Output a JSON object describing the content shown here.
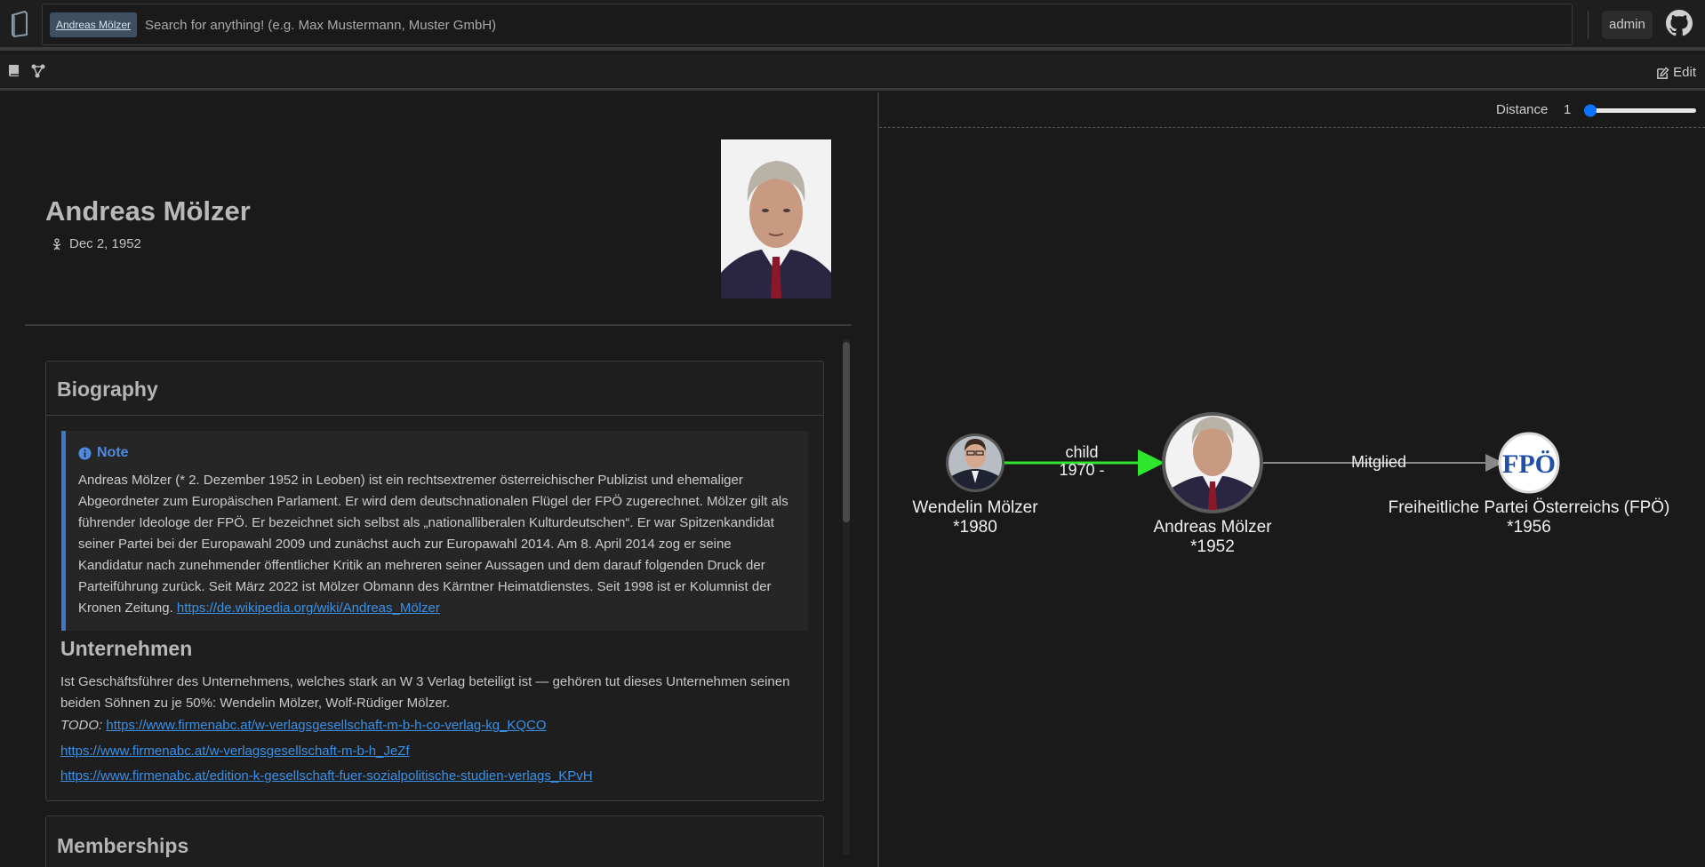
{
  "header": {
    "active_tag": "Andreas Mölzer",
    "search_placeholder": "Search for anything! (e.g. Max Mustermann, Muster GmbH)",
    "user_label": "admin"
  },
  "toolbar": {
    "edit_label": "Edit"
  },
  "person": {
    "name": "Andreas Mölzer",
    "birth_date": "Dec 2, 1952"
  },
  "biography": {
    "title": "Biography",
    "note_title": "Note",
    "note_text": "Andreas Mölzer (* 2. Dezember 1952 in Leoben) ist ein rechtsextremer österreichischer Publizist und ehemaliger Abgeordneter zum Europäischen Parlament. Er wird dem deutschnationalen Flügel der FPÖ zugerechnet. Mölzer gilt als führender Ideologe der FPÖ. Er bezeichnet sich selbst als „nationalliberalen Kulturdeutschen“. Er war Spitzenkandidat seiner Partei bei der Europawahl 2009 und zunächst auch zur Europawahl 2014. Am 8. April 2014 zog er seine Kandidatur nach zunehmender öffentlicher Kritik an mehreren seiner Aussagen und dem darauf folgenden Druck der Parteiführung zurück. Seit März 2022 ist Mölzer Obmann des Kärntner Heimatdienstes. Seit 1998 ist er Kolumnist der Kronen Zeitung. ",
    "note_link": "https://de.wikipedia.org/wiki/Andreas_Mölzer",
    "section_title": "Unternehmen",
    "section_text": "Ist Geschäftsführer des Unternehmens, welches stark an W 3 Verlag beteiligt ist — gehören tut dieses Unternehmen seinen beiden Söhnen zu je 50%: Wendelin Mölzer, Wolf-Rüdiger Mölzer.",
    "todo_label": "TODO:",
    "links": [
      "https://www.firmenabc.at/w-verlagsgesellschaft-m-b-h-co-verlag-kg_KQCO",
      "https://www.firmenabc.at/w-verlagsgesellschaft-m-b-h_JeZf",
      "https://www.firmenabc.at/edition-k-gesellschaft-fuer-sozialpolitische-studien-verlags_KPvH"
    ]
  },
  "memberships": {
    "title": "Memberships"
  },
  "graph": {
    "distance_label": "Distance",
    "distance_value": "1",
    "nodes": [
      {
        "name": "Wendelin Mölzer",
        "sub": "*1980"
      },
      {
        "name": "Andreas Mölzer",
        "sub": "*1952"
      },
      {
        "name": "Freiheitliche Partei Österreichs (FPÖ)",
        "sub": "*1956",
        "logo_text": "FPÖ"
      }
    ],
    "edges": [
      {
        "label": "child",
        "sub": "1970 -",
        "color": "#2ee62e"
      },
      {
        "label": "Mitglied",
        "color": "#888888"
      }
    ]
  },
  "colors": {
    "accent_blue": "#3f77c9",
    "link_blue": "#3a91e8",
    "edge_green": "#2ee62e"
  }
}
